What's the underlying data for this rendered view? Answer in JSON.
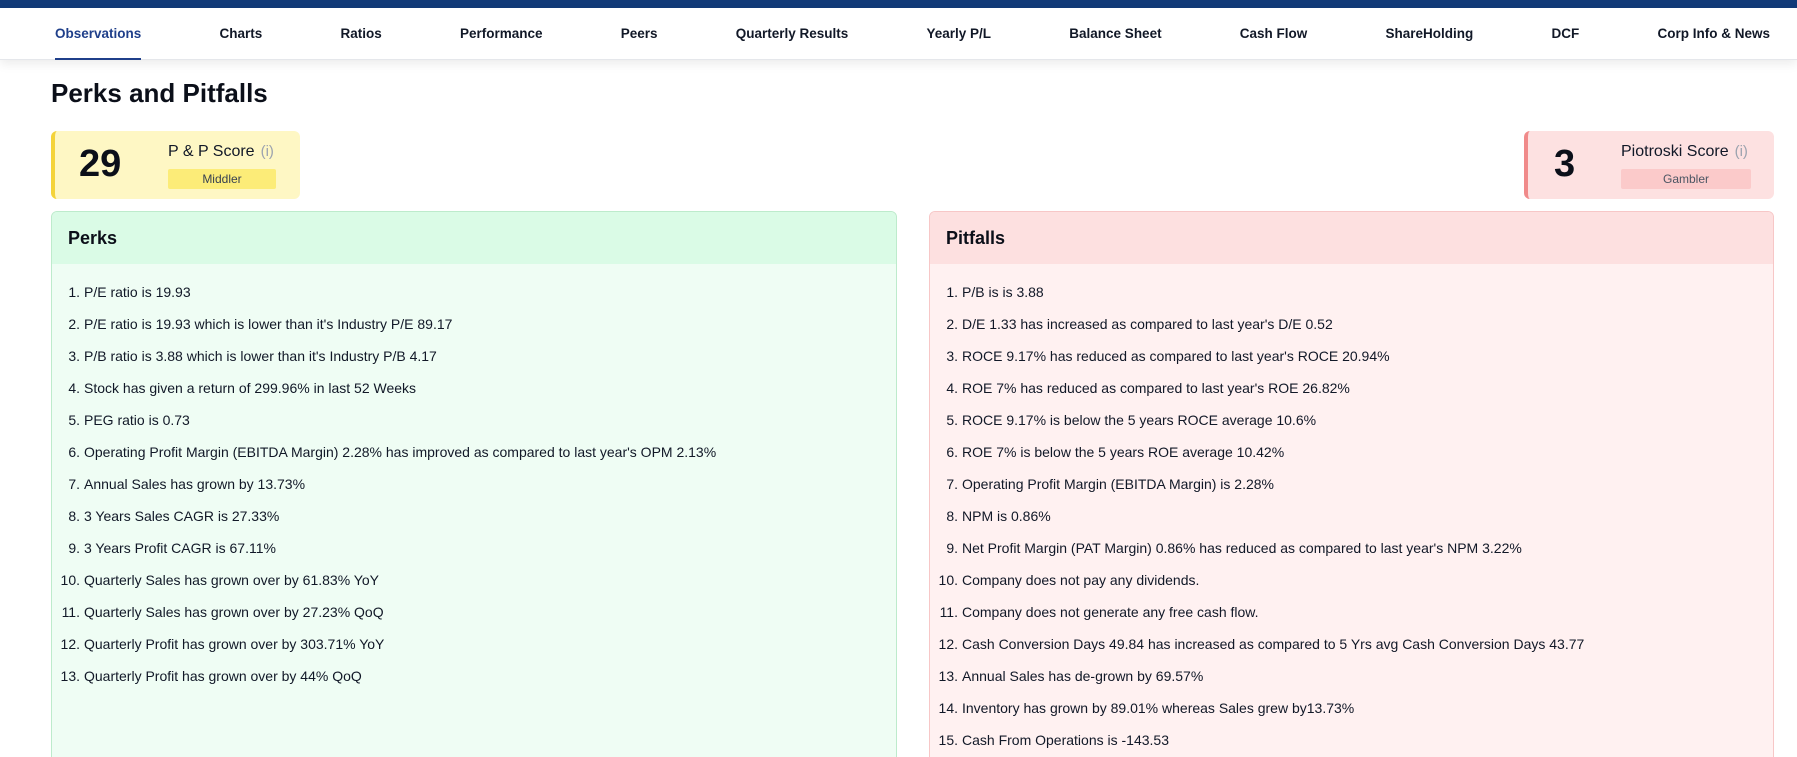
{
  "tabs": [
    {
      "label": "Observations",
      "active": true
    },
    {
      "label": "Charts"
    },
    {
      "label": "Ratios"
    },
    {
      "label": "Performance"
    },
    {
      "label": "Peers"
    },
    {
      "label": "Quarterly Results"
    },
    {
      "label": "Yearly P/L"
    },
    {
      "label": "Balance Sheet"
    },
    {
      "label": "Cash Flow"
    },
    {
      "label": "ShareHolding"
    },
    {
      "label": "DCF"
    },
    {
      "label": "Corp Info & News"
    }
  ],
  "page_title": "Perks and Pitfalls",
  "pp_score": {
    "value": "29",
    "label": "P & P Score",
    "info": "(i)",
    "badge": "Middler"
  },
  "piotroski_score": {
    "value": "3",
    "label": "Piotroski Score",
    "info": "(i)",
    "badge": "Gambler"
  },
  "perks": {
    "title": "Perks",
    "items": [
      "P/E ratio is 19.93",
      "P/E ratio is 19.93 which is lower than it's Industry P/E 89.17",
      "P/B ratio is 3.88 which is lower than it's Industry P/B 4.17",
      "Stock has given a return of 299.96% in last 52 Weeks",
      "PEG ratio is 0.73",
      "Operating Profit Margin (EBITDA Margin) 2.28% has improved as compared to last year's OPM 2.13%",
      "Annual Sales has grown by 13.73%",
      "3 Years Sales CAGR is 27.33%",
      "3 Years Profit CAGR is 67.11%",
      "Quarterly Sales has grown over by 61.83% YoY",
      "Quarterly Sales has grown over by 27.23% QoQ",
      "Quarterly Profit has grown over by 303.71% YoY",
      "Quarterly Profit has grown over by 44% QoQ"
    ]
  },
  "pitfalls": {
    "title": "Pitfalls",
    "items": [
      "P/B is is 3.88",
      "D/E 1.33 has increased as compared to last year's D/E 0.52",
      "ROCE 9.17% has reduced as compared to last year's ROCE 20.94%",
      "ROE 7% has reduced as compared to last year's ROE 26.82%",
      "ROCE 9.17% is below the 5 years ROCE average 10.6%",
      "ROE 7% is below the 5 years ROE average 10.42%",
      "Operating Profit Margin (EBITDA Margin) is 2.28%",
      "NPM is 0.86%",
      "Net Profit Margin (PAT Margin) 0.86% has reduced as compared to last year's NPM 3.22%",
      "Company does not pay any dividends.",
      "Company does not generate any free cash flow.",
      "Cash Conversion Days 49.84 has increased as compared to 5 Yrs avg Cash Conversion Days 43.77",
      "Annual Sales has de-grown by 69.57%",
      "Inventory has grown by 89.01% whereas Sales grew by13.73%",
      "Cash From Operations is -143.53"
    ]
  }
}
